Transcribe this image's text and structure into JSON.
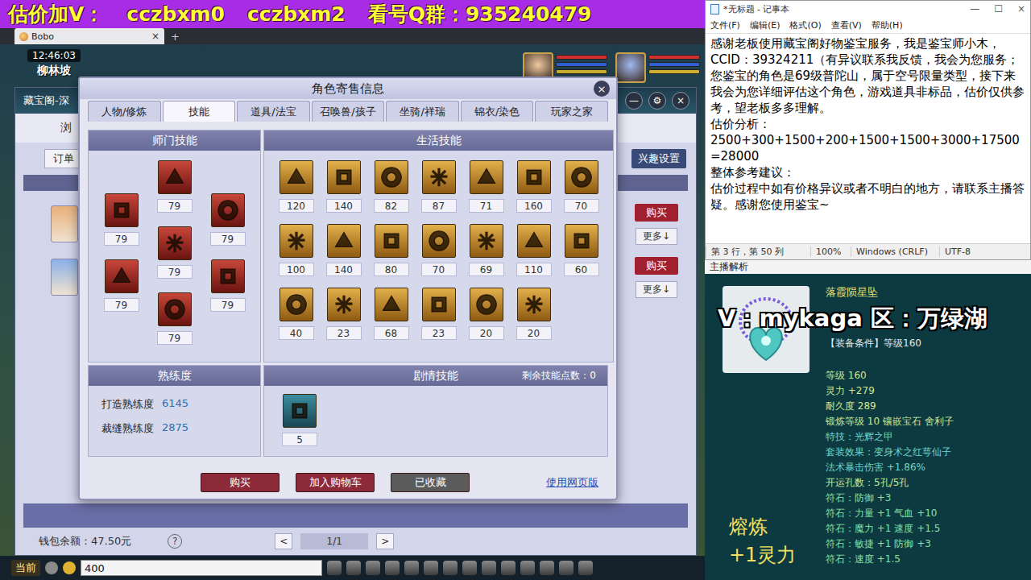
{
  "banner": {
    "parts": [
      "估价加V：",
      "cczbxm0",
      "cczbxm2",
      "看号Q群：935240479"
    ]
  },
  "browser_tab": {
    "title": "Bobo",
    "close": "×",
    "new_tab": "+"
  },
  "hud": {
    "time": "12:46:03",
    "location": "柳林坡"
  },
  "back_window": {
    "title": "藏宝阁-深",
    "controls": [
      "—",
      "⚙",
      "×"
    ],
    "nav": "浏",
    "order": "订单",
    "interest_button": "兴趣设置",
    "listings": [
      {
        "buy": "购买",
        "more": "更多↓"
      },
      {
        "buy": "购买",
        "more": "更多↓"
      }
    ],
    "wallet": "钱包余额：47.50元",
    "help": "?",
    "pagination": {
      "prev": "<",
      "page": "1/1",
      "next": ">"
    }
  },
  "chat": {
    "channel": "当前",
    "input": "400"
  },
  "dialog": {
    "title": "角色寄售信息",
    "close": "×",
    "tabs": [
      {
        "label": "人物/修炼",
        "selected": false
      },
      {
        "label": "技能",
        "selected": true
      },
      {
        "label": "道具/法宝",
        "selected": false
      },
      {
        "label": "召唤兽/孩子",
        "selected": false
      },
      {
        "label": "坐骑/祥瑞",
        "selected": false
      },
      {
        "label": "锦衣/染色",
        "selected": false
      },
      {
        "label": "玩家之家",
        "selected": false
      }
    ],
    "school_skills": {
      "title": "师门技能",
      "items": [
        "79",
        "79",
        "79",
        "79",
        "79",
        "79",
        "79"
      ]
    },
    "life_skills": {
      "title": "生活技能",
      "items": [
        "120",
        "140",
        "82",
        "87",
        "71",
        "160",
        "70",
        "100",
        "140",
        "80",
        "70",
        "69",
        "110",
        "60",
        "40",
        "23",
        "68",
        "23",
        "20",
        "20"
      ]
    },
    "proficiency": {
      "title": "熟练度",
      "items": [
        {
          "label": "打造熟练度",
          "value": "6145"
        },
        {
          "label": "裁缝熟练度",
          "value": "2875"
        }
      ]
    },
    "story_skills": {
      "title": "剧情技能",
      "points": "剩余技能点数：0",
      "items": [
        "5"
      ]
    },
    "buttons": [
      {
        "label": "购买",
        "kind": "primary"
      },
      {
        "label": "加入购物车",
        "kind": "primary"
      },
      {
        "label": "已收藏",
        "kind": "muted"
      }
    ],
    "link": "使用网页版"
  },
  "notepad": {
    "title": "*无标题 - 记事本",
    "controls": [
      "—",
      "☐",
      "×"
    ],
    "menu": [
      "文件(F)",
      "编辑(E)",
      "格式(O)",
      "查看(V)",
      "帮助(H)"
    ],
    "lines": [
      "感谢老板使用藏宝阁好物鉴宝服务，我是鉴宝师小木，CCID：39324211（有异议联系我反馈，我会为您服务；",
      "您鉴宝的角色是69级普陀山，属于空号限量类型，接下来我会为您详细评估这个角色，游戏道具非标品，估价仅供参考，望老板多多理解。",
      "估价分析：",
      "2500+300+1500+200+1500+1500+3000+17500=28000",
      "整体参考建议：",
      "估价过程中如有价格异议或者不明白的地方，请联系主播答疑。感谢您使用鉴宝~"
    ],
    "status": [
      "第 3 行，第 50 列",
      "100%",
      "Windows (CRLF)",
      "UTF-8"
    ]
  },
  "caption": "主播解析",
  "item": {
    "name": "落霞陨星坠",
    "watermark": "V：mykaga  区：万绿湖",
    "requirement": "【装备条件】等级160",
    "stats": [
      {
        "text": "等级 160",
        "color": "#c8e89a"
      },
      {
        "text": "灵力 +279",
        "color": "#c8e89a"
      },
      {
        "text": "耐久度 289",
        "color": "#c8e89a"
      },
      {
        "text": "锻炼等级 10 镶嵌宝石 舍利子",
        "color": "#c8e89a"
      },
      {
        "text": "特技：光辉之甲",
        "color": "#6fd6cc"
      },
      {
        "text": "套装效果：变身术之红萼仙子",
        "color": "#6fd6cc"
      },
      {
        "text": "法术暴击伤害 +1.86%",
        "color": "#6fd6cc"
      },
      {
        "text": "开运孔数：5孔/5孔",
        "color": "#c8e89a"
      },
      {
        "text": "符石：防御 +3",
        "color": "#86e0a8"
      },
      {
        "text": "符石：力量 +1 气血 +10",
        "color": "#86e0a8"
      },
      {
        "text": "符石：魔力 +1 速度 +1.5",
        "color": "#86e0a8"
      },
      {
        "text": "符石：敏捷 +1 防御 +3",
        "color": "#86e0a8"
      },
      {
        "text": "符石：速度 +1.5",
        "color": "#86e0a8"
      }
    ],
    "smelt": [
      "熔炼",
      "+1灵力"
    ]
  }
}
